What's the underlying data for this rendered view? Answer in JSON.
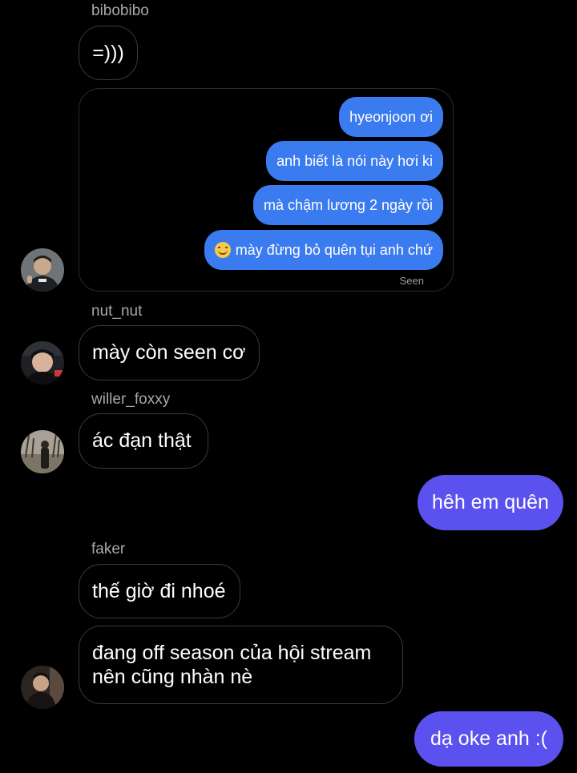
{
  "colors": {
    "background": "#000000",
    "outgoing_bubble": "#5b51ef",
    "embedded_bubble": "#3b7bf0",
    "incoming_border": "#3a3a3a",
    "sender_name": "#a8a8a8"
  },
  "thread": [
    {
      "sender": "bibobibo",
      "text": "=)))"
    },
    {
      "embedded_screenshot": {
        "messages": [
          "hyeonjoon ơi",
          "anh biết là nói này hơi ki",
          "mà chậm lương 2 ngày rồi",
          "mày đừng bỏ quên tụi anh chứ"
        ],
        "last_emoji": "smiling-face-emoji",
        "status": "Seen"
      }
    },
    {
      "sender": "nut_nut",
      "text": "mày còn seen cơ"
    },
    {
      "sender": "willer_foxxy",
      "text": "ác đạn thật"
    },
    {
      "outgoing": "hêh em quên"
    },
    {
      "sender": "faker",
      "text": "thế giờ đi nhoé"
    },
    {
      "text": "đang off season của hội stream\nnên cũng nhàn nè"
    },
    {
      "outgoing": "dạ oke anh :("
    }
  ]
}
